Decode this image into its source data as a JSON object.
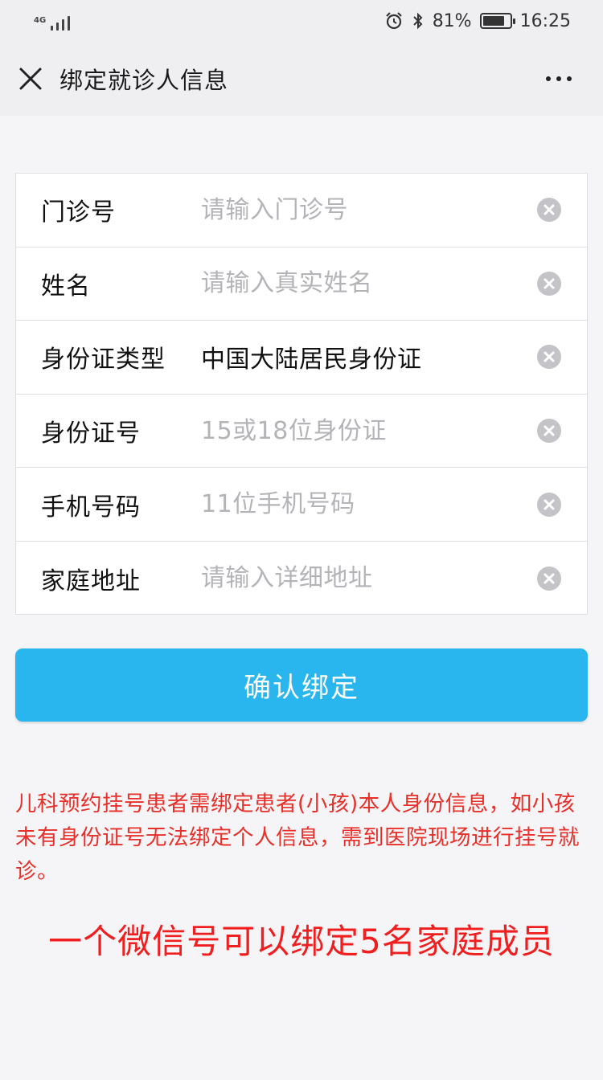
{
  "status_bar": {
    "network": "4G",
    "battery_percent": "81%",
    "battery_level": 0.81,
    "time": "16:25"
  },
  "nav": {
    "title": "绑定就诊人信息"
  },
  "form": {
    "rows": [
      {
        "label": "门诊号",
        "value": "",
        "placeholder": "请输入门诊号"
      },
      {
        "label": "姓名",
        "value": "",
        "placeholder": "请输入真实姓名"
      },
      {
        "label": "身份证类型",
        "value": "中国大陆居民身份证",
        "placeholder": ""
      },
      {
        "label": "身份证号",
        "value": "",
        "placeholder": "15或18位身份证"
      },
      {
        "label": "手机号码",
        "value": "",
        "placeholder": "11位手机号码"
      },
      {
        "label": "家庭地址",
        "value": "",
        "placeholder": "请输入详细地址"
      }
    ]
  },
  "confirm_label": "确认绑定",
  "notice": "儿科预约挂号患者需绑定患者(小孩)本人身份信息，如小孩未有身份证号无法绑定个人信息，需到医院现场进行挂号就诊。",
  "headline": "一个微信号可以绑定5名家庭成员",
  "colors": {
    "accent": "#29b6ef",
    "notice_red": "#e8302a",
    "headline_red": "#f01e1e"
  }
}
